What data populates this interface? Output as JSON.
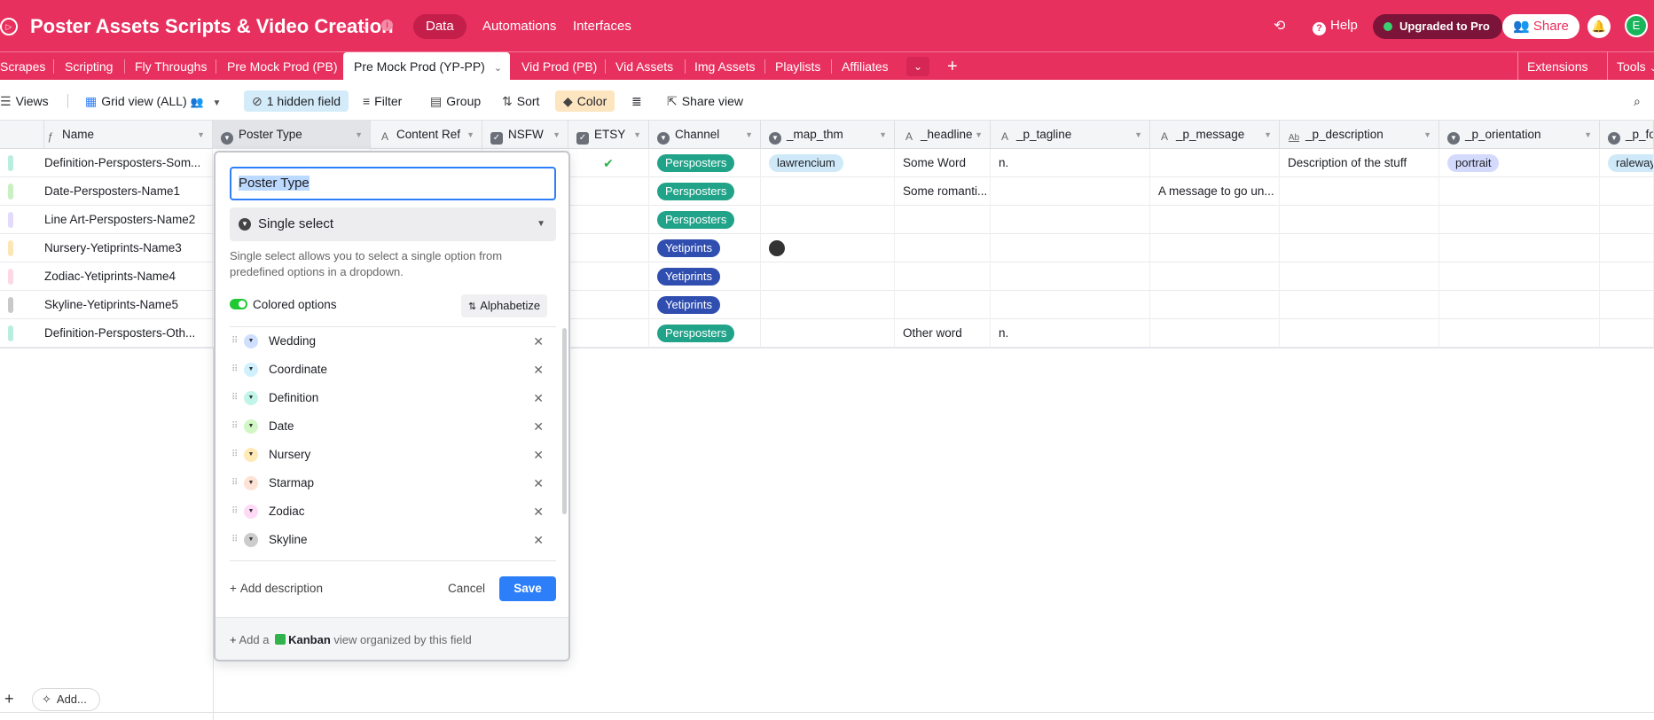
{
  "app": {
    "title": "Poster Assets Scripts & Video Creation",
    "nav": [
      "Data",
      "Automations",
      "Interfaces"
    ],
    "help": "Help",
    "upgraded": "Upgraded to Pro",
    "share": "Share",
    "avatar_initial": "E",
    "accent_color": "#e8305f"
  },
  "tabs": {
    "items": [
      "Scrapes",
      "Scripting",
      "Fly Throughs",
      "Pre Mock Prod (PB)",
      "Pre Mock Prod (YP-PP)",
      "Vid Prod (PB)",
      "Vid Assets",
      "Img Assets",
      "Playlists",
      "Affiliates"
    ],
    "active": "Pre Mock Prod (YP-PP)",
    "extensions": "Extensions",
    "tools": "Tools"
  },
  "toolbar": {
    "views": "Views",
    "grid_view": "Grid view (ALL)",
    "hidden_field": "1 hidden field",
    "filter": "Filter",
    "group": "Group",
    "sort": "Sort",
    "color": "Color",
    "share_view": "Share view"
  },
  "columns": [
    "Name",
    "Poster Type",
    "Content Ref",
    "NSFW",
    "ETSY",
    "Channel",
    "_map_thm",
    "_headline",
    "_p_tagline",
    "_p_message",
    "_p_description",
    "_p_orientation",
    "_p_fo"
  ],
  "rows": [
    {
      "name": "Definition-Persposters-Som...",
      "etsy": "✔",
      "channel": "Persposters",
      "map_thm": "lawrencium",
      "headline": "Some Word",
      "tagline": "n.",
      "message": "",
      "description": "Description of the stuff",
      "orientation": "portrait",
      "font": "raleway",
      "color": "#b8ede0"
    },
    {
      "name": "Date-Persposters-Name1",
      "etsy": "",
      "channel": "Persposters",
      "map_thm": "",
      "headline": "Some romanti...",
      "tagline": "",
      "message": "A message to go un...",
      "description": "",
      "orientation": "",
      "font": "",
      "color": "#c9f0c0"
    },
    {
      "name": "Line Art-Persposters-Name2",
      "etsy": "",
      "channel": "Persposters",
      "map_thm": "",
      "headline": "",
      "tagline": "",
      "message": "",
      "description": "",
      "orientation": "",
      "font": "",
      "color": "#e4dafc"
    },
    {
      "name": "Nursery-Yetiprints-Name3",
      "etsy": "",
      "channel": "Yetiprints",
      "map_thm": "●",
      "headline": "",
      "tagline": "",
      "message": "",
      "description": "",
      "orientation": "",
      "font": "",
      "color": "#fde6b6"
    },
    {
      "name": "Zodiac-Yetiprints-Name4",
      "etsy": "",
      "channel": "Yetiprints",
      "map_thm": "",
      "headline": "",
      "tagline": "",
      "message": "",
      "description": "",
      "orientation": "",
      "font": "",
      "color": "#fcd8e4"
    },
    {
      "name": "Skyline-Yetiprints-Name5",
      "etsy": "",
      "channel": "Yetiprints",
      "map_thm": "",
      "headline": "",
      "tagline": "",
      "message": "",
      "description": "",
      "orientation": "",
      "font": "",
      "color": "#c9c9cc"
    },
    {
      "name": "Definition-Persposters-Oth...",
      "etsy": "",
      "channel": "Persposters",
      "map_thm": "",
      "headline": "Other word",
      "tagline": "n.",
      "message": "",
      "description": "",
      "orientation": "",
      "font": "",
      "color": "#b8ede0"
    }
  ],
  "footer": {
    "add": "Add..."
  },
  "field_editor": {
    "field_name": "Poster Type",
    "type": "Single select",
    "description": "Single select allows you to select a single option from predefined options in a dropdown.",
    "colored_options": "Colored options",
    "alphabetize": "Alphabetize",
    "options": [
      {
        "label": "Wedding",
        "color": "#cfdfff"
      },
      {
        "label": "Coordinate",
        "color": "#d0f0fd"
      },
      {
        "label": "Definition",
        "color": "#c2f5e9"
      },
      {
        "label": "Date",
        "color": "#d1f7c4"
      },
      {
        "label": "Nursery",
        "color": "#ffeab6"
      },
      {
        "label": "Starmap",
        "color": "#fee2d5"
      },
      {
        "label": "Zodiac",
        "color": "#ffdaf6"
      },
      {
        "label": "Skyline",
        "color": "#cccccc"
      }
    ],
    "add_description": "Add description",
    "cancel": "Cancel",
    "save": "Save",
    "kanban_prefix": "Add a",
    "kanban_bold": "Kanban",
    "kanban_suffix": "view organized by this field"
  }
}
